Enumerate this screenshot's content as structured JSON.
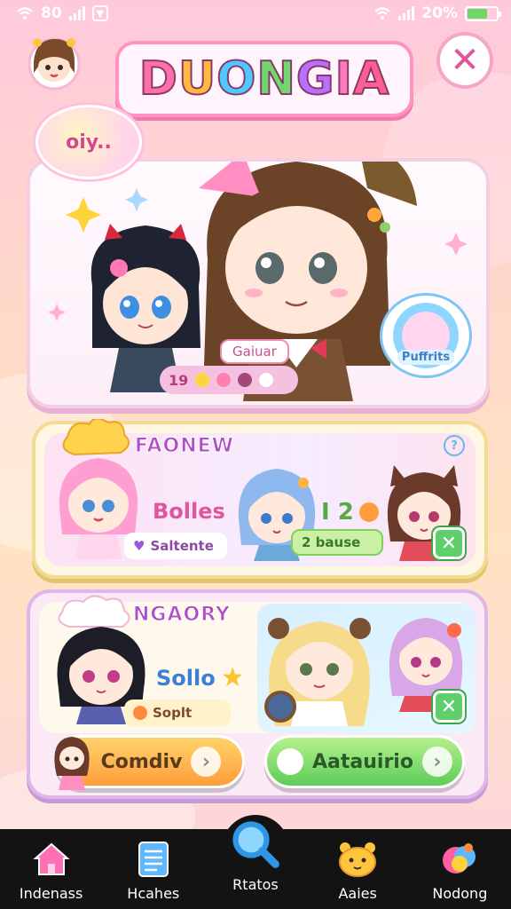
{
  "status_bar": {
    "left_text": "80",
    "right_text": "20%",
    "battery_level": 0.7
  },
  "header": {
    "logo_text": "DUONGIA",
    "logo_colors": [
      "#ff6fa8",
      "#ffb93d",
      "#4fc7ff",
      "#6fd76c",
      "#b770ff",
      "#ff7bbd",
      "#ff5f8f"
    ],
    "close_icon": "close-icon"
  },
  "bubble": {
    "text": "oiy.."
  },
  "hero": {
    "tag_label": "Gaiuar",
    "stats_number": "19",
    "badge_label": "Puffrits"
  },
  "card_friends": {
    "heading": "FAONEW",
    "mid_label": "Bolles",
    "pill_label": "Saltente",
    "score_pill": "2 bause",
    "counter_text": "I 2"
  },
  "card_memory": {
    "heading": "NGAORY",
    "mid_label": "Sollo",
    "pill_label": "Soplt"
  },
  "buttons": {
    "left_label": "Comdiv",
    "right_label": "Aatauirio"
  },
  "tabs": [
    {
      "label": "Indenass",
      "icon": "home-icon"
    },
    {
      "label": "Hcahes",
      "icon": "document-icon"
    },
    {
      "label": "Rtatos",
      "icon": "search-icon"
    },
    {
      "label": "Aaies",
      "icon": "bear-icon"
    },
    {
      "label": "Nodong",
      "icon": "heart-bubble-icon"
    }
  ],
  "colors": {
    "accent_pink": "#ff93c1",
    "tab_bar": "#131313",
    "green": "#5fcf6b",
    "orange": "#ff9d3c"
  }
}
